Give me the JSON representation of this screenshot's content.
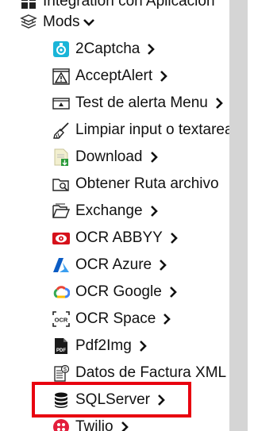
{
  "tree": {
    "top_item": {
      "label": "Integration con Aplicacion"
    },
    "mods": {
      "label": "Mods",
      "items": [
        {
          "label": "2Captcha",
          "icon": "captcha-icon",
          "has_chevron": true
        },
        {
          "label": "AcceptAlert",
          "icon": "alert-warning-icon",
          "has_chevron": true
        },
        {
          "label": "Test de alerta Menu",
          "icon": "alert-window-icon",
          "has_chevron": true
        },
        {
          "label": "Limpiar input o textarea",
          "icon": "broom-icon",
          "has_chevron": false
        },
        {
          "label": "Download",
          "icon": "download-file-icon",
          "has_chevron": true
        },
        {
          "label": "Obtener Ruta archivo",
          "icon": "folder-search-icon",
          "has_chevron": false
        },
        {
          "label": "Exchange",
          "icon": "folder-open-icon",
          "has_chevron": true
        },
        {
          "label": "OCR ABBYY",
          "icon": "abbyy-eye-icon",
          "has_chevron": true
        },
        {
          "label": "OCR Azure",
          "icon": "azure-logo-icon",
          "has_chevron": true
        },
        {
          "label": "OCR Google",
          "icon": "google-cloud-icon",
          "has_chevron": true
        },
        {
          "label": "OCR Space",
          "icon": "ocr-scan-icon",
          "has_chevron": true
        },
        {
          "label": "Pdf2Img",
          "icon": "pdf-file-icon",
          "has_chevron": true
        },
        {
          "label": "Datos de Factura XML",
          "icon": "invoice-icon",
          "has_chevron": false
        },
        {
          "label": "SQLServer",
          "icon": "database-icon",
          "has_chevron": true
        },
        {
          "label": "Twilio",
          "icon": "twilio-icon",
          "has_chevron": true
        }
      ]
    }
  },
  "colors": {
    "highlight_border": "#e8000f",
    "scrollbar": "#d5d5d5"
  }
}
